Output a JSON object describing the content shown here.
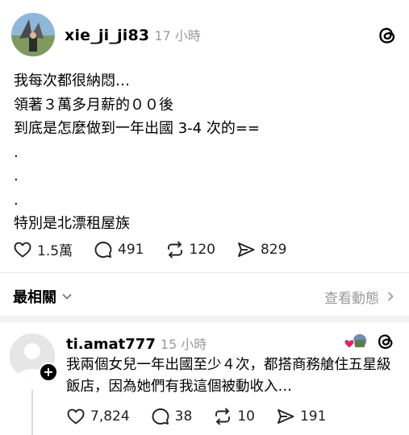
{
  "post": {
    "username": "xie_ji_ji83",
    "time": "17 小時",
    "lines": [
      "我每次都很納悶…",
      "領著３萬多月薪的００後",
      "到底是怎麼做到一年出國 3-4 次的==",
      ".",
      ".",
      ".",
      "特別是北漂租屋族"
    ],
    "actions": {
      "likes": "1.5萬",
      "comments": "491",
      "reposts": "120",
      "shares": "829"
    }
  },
  "sort": {
    "label": "最相關",
    "view_activity": "查看動態"
  },
  "reply": {
    "username": "ti.amat777",
    "time": "15 小時",
    "text": "我兩個女兒一年出國至少４次，都搭商務艙住五星級飯店，因為她們有我這個被動收入…",
    "actions": {
      "likes": "7,824",
      "comments": "38",
      "reposts": "10",
      "shares": "191"
    }
  },
  "colors": {
    "muted": "#9a9a9a",
    "like_heart": "#e0245e"
  },
  "icons": [
    "threads-icon",
    "heart-icon",
    "comment-icon",
    "repost-icon",
    "share-icon",
    "chevron-down-icon",
    "chevron-right-icon",
    "plus-icon"
  ]
}
